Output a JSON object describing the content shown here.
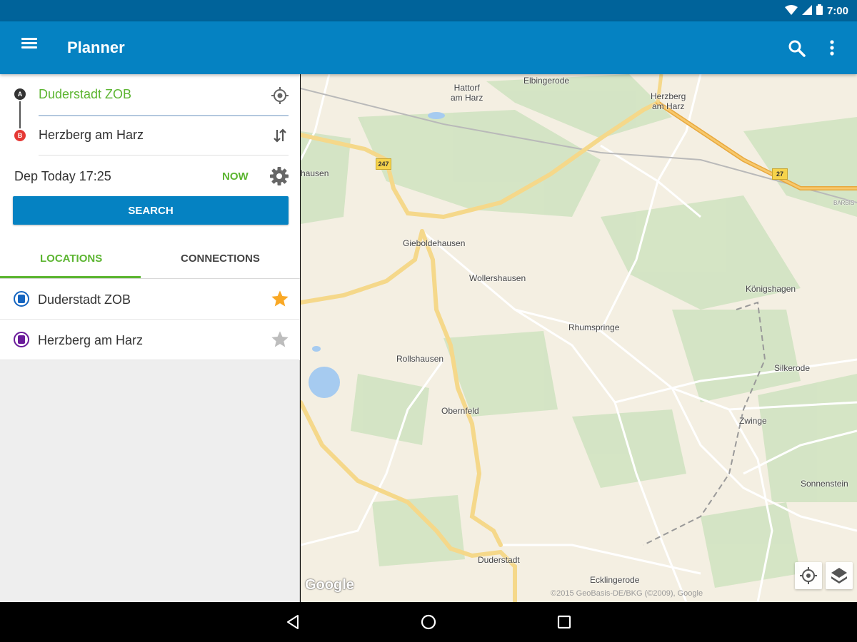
{
  "status_bar": {
    "time": "7:00"
  },
  "toolbar": {
    "title": "Planner"
  },
  "planner": {
    "marker_a": "A",
    "marker_b": "B",
    "from": "Duderstadt ZOB",
    "to": "Herzberg am Harz",
    "departure": "Dep  Today  17:25",
    "now_label": "NOW",
    "search_label": "SEARCH"
  },
  "tabs": [
    {
      "label": "LOCATIONS",
      "active": true
    },
    {
      "label": "CONNECTIONS",
      "active": false
    }
  ],
  "locations": [
    {
      "label": "Duderstadt ZOB",
      "icon": "bus-stop-icon",
      "color": "#1565c0",
      "favorite": true
    },
    {
      "label": "Herzberg am Harz",
      "icon": "train-station-icon",
      "color": "#6a1b9a",
      "favorite": false
    }
  ],
  "map": {
    "labels": [
      "Hattorf\nam Harz",
      "Elbingerode",
      "Herzberg\nam Harz",
      "hausen",
      "Gieboldehausen",
      "Wollershausen",
      "Königshagen",
      "Rhumspringe",
      "Rollshausen",
      "Silkerode",
      "Obernfeld",
      "Zwinge",
      "Sonnenstein",
      "Duderstadt",
      "Ecklingerode",
      "BARBIS"
    ],
    "shields": [
      "247",
      "27"
    ],
    "logo": "Google",
    "attribution": "©2015 GeoBasis-DE/BKG (©2009), Google"
  },
  "colors": {
    "primary": "#0582c2",
    "accent_green": "#5cb531",
    "status_bar": "#00639a",
    "star_active": "#f9a825",
    "star_inactive": "#bdbdbd"
  }
}
